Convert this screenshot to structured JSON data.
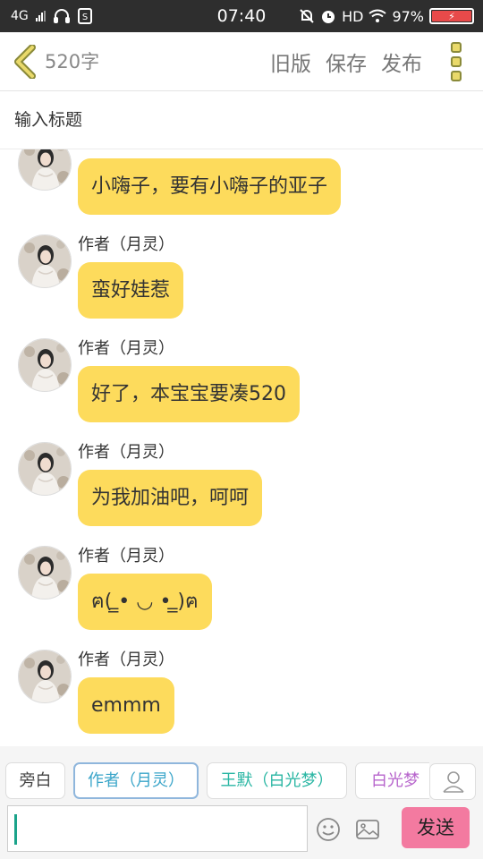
{
  "status_bar": {
    "network": "4G",
    "time": "07:40",
    "hd": "HD",
    "battery": "97%"
  },
  "header": {
    "word_count": "520字",
    "actions": {
      "old_version": "旧版",
      "save": "保存",
      "publish": "发布"
    }
  },
  "title_input": {
    "placeholder": "输入标题"
  },
  "messages": [
    {
      "speaker": "",
      "text": "小嗨子，要有小嗨子的亚子"
    },
    {
      "speaker": "作者（月灵）",
      "text": "蛮好娃惹"
    },
    {
      "speaker": "作者（月灵）",
      "text": "好了，本宝宝要凑520"
    },
    {
      "speaker": "作者（月灵）",
      "text": "为我加油吧，呵呵"
    },
    {
      "speaker": "作者（月灵）",
      "text": "ฅ( ̳• ◡ • ̳)ฅ"
    },
    {
      "speaker": "作者（月灵）",
      "text": "emmm"
    }
  ],
  "character_bar": {
    "chips": [
      "旁白",
      "作者（月灵）",
      "王默（白光梦）",
      "白光梦（"
    ],
    "active_chip": "作者（月灵）",
    "send_label": "发送"
  },
  "colors": {
    "bubble": "#fddb5c",
    "send_button": "#f37aa0",
    "active_chip_text": "#3aa5c9",
    "chip3_text": "#29b6a3",
    "chip4_text": "#b764cc"
  },
  "icons": [
    "back-icon",
    "more-icon",
    "user-icon",
    "emoji-icon",
    "image-icon"
  ]
}
